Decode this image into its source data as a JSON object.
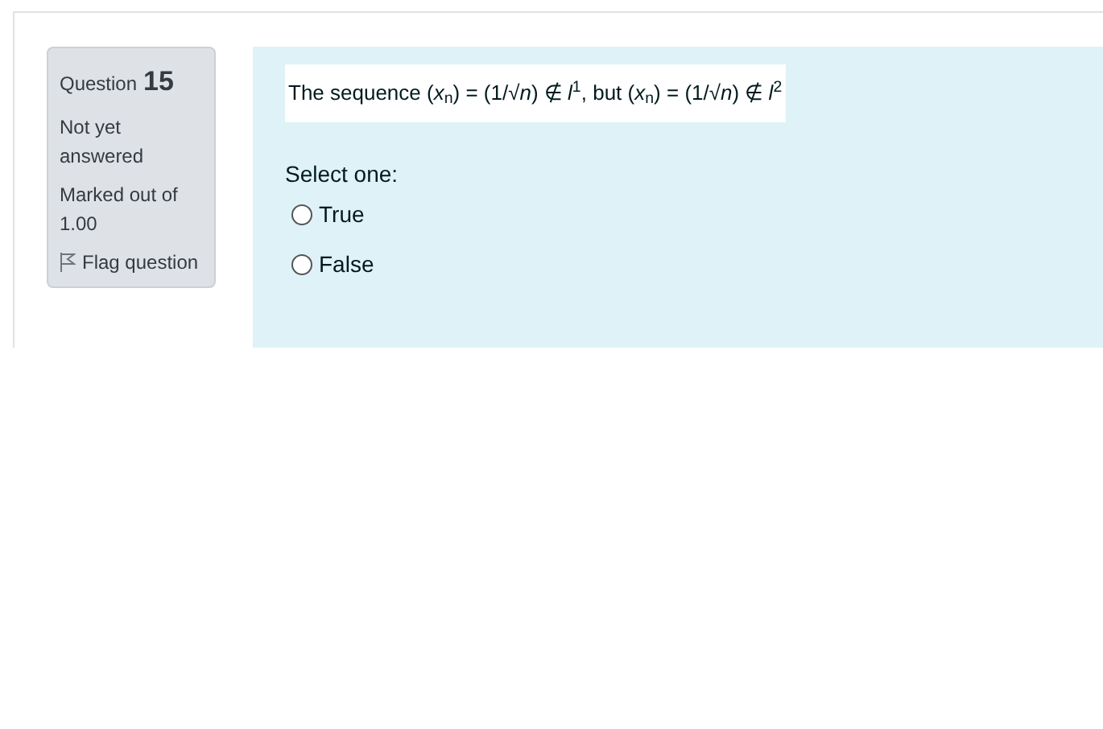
{
  "info": {
    "label": "Question",
    "number": "15",
    "state": "Not yet answered",
    "marks": "Marked out of 1.00",
    "flag": "Flag question"
  },
  "question": {
    "text": "The sequence (*x*$_{n}$) = (1/√*n*) ∉ *l*$^{1}$,  but  (*x*$_{n}$) = (1/√*n*) ∉ *l*$^{2}$",
    "prompt": "Select one:",
    "options": [
      {
        "label": "True",
        "selected": false
      },
      {
        "label": "False",
        "selected": false
      }
    ]
  }
}
